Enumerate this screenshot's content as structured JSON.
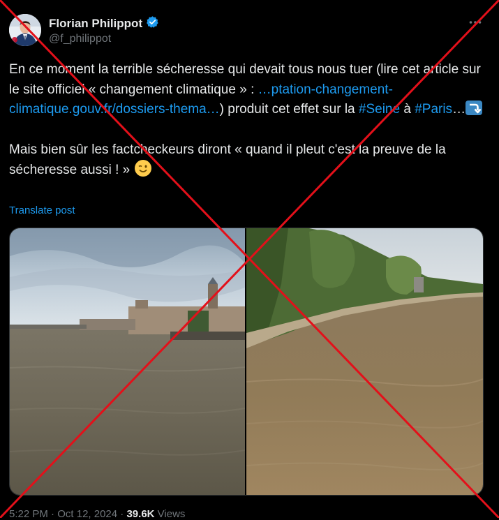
{
  "author": {
    "display_name": "Florian Philippot",
    "handle": "@f_philippot",
    "verified": true
  },
  "more_icon": "more-horizontal-icon",
  "text": {
    "p1_a": "En ce moment la terrible sécheresse qui devait tous nous tuer (lire cet article sur le site officiel « changement climatique » : ",
    "p1_link": "…ptation-changement-climatique.gouv.fr/dossiers-thema…",
    "p1_b": ") produit cet effet sur la ",
    "hashtag_seine": "#Seine",
    "p1_c": " à ",
    "hashtag_paris": "#Paris",
    "p1_d": "…",
    "arrow_emoji": "arrow-right-hook-down-emoji",
    "p2": "Mais bien sûr les factcheckeurs diront « quand il pleut c'est la preuve de la sécheresse aussi ! » ",
    "wink_emoji": "winking-face-emoji"
  },
  "translate_label": "Translate post",
  "media": {
    "left_photo": "Seine river in Paris, high water near Musée d'Orsay",
    "right_photo": "Flooded Seine quay lined with trees"
  },
  "meta": {
    "time": "5:22 PM",
    "sep1": " · ",
    "date": "Oct 12, 2024",
    "sep2": " · ",
    "views_count": "39.6K",
    "views_label": " Views"
  },
  "colors": {
    "background": "#000000",
    "text": "#e7e9ea",
    "secondary": "#71767b",
    "link": "#1d9bf0",
    "cross": "#e3101a"
  }
}
